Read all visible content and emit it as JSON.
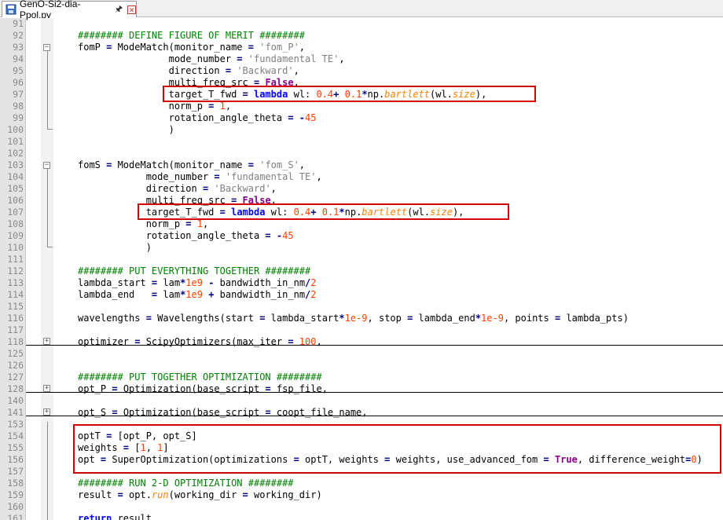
{
  "tab": {
    "filename": "GenO-Si2-dia-Ppol.py",
    "pin_icon": "pin-icon",
    "close_icon": "close-icon"
  },
  "lines": [
    {
      "n": "91",
      "t": []
    },
    {
      "n": "92",
      "t": [
        [
          "cm",
          "######## DEFINE FIGURE OF MERIT ########"
        ]
      ]
    },
    {
      "n": "93",
      "t": [
        [
          "",
          "fomP "
        ],
        [
          "op",
          "="
        ],
        [
          "",
          " ModeMatch(monitor_name "
        ],
        [
          "op",
          "="
        ],
        [
          "",
          " "
        ],
        [
          "str",
          "'fom_P'"
        ],
        [
          "",
          ","
        ]
      ]
    },
    {
      "n": "94",
      "t": [
        [
          "",
          "                mode_number "
        ],
        [
          "op",
          "="
        ],
        [
          "",
          " "
        ],
        [
          "str",
          "'fundamental TE'"
        ],
        [
          "",
          ","
        ]
      ]
    },
    {
      "n": "95",
      "t": [
        [
          "",
          "                direction "
        ],
        [
          "op",
          "="
        ],
        [
          "",
          " "
        ],
        [
          "str",
          "'Backward'"
        ],
        [
          "",
          ","
        ]
      ]
    },
    {
      "n": "96",
      "t": [
        [
          "",
          "                multi_freq_src "
        ],
        [
          "op",
          "="
        ],
        [
          "",
          " "
        ],
        [
          "bi",
          "False"
        ],
        [
          "",
          ","
        ]
      ]
    },
    {
      "n": "97",
      "t": [
        [
          "",
          "                target_T_fwd "
        ],
        [
          "op",
          "="
        ],
        [
          "",
          " "
        ],
        [
          "kw",
          "lambda"
        ],
        [
          "",
          " wl: "
        ],
        [
          "num",
          "0.4"
        ],
        [
          "op",
          "+"
        ],
        [
          "",
          " "
        ],
        [
          "num",
          "0.1"
        ],
        [
          "op",
          "*"
        ],
        [
          "",
          "np."
        ],
        [
          "it",
          "bartlett"
        ],
        [
          "",
          "(wl."
        ],
        [
          "it",
          "size"
        ],
        [
          "",
          "),"
        ]
      ]
    },
    {
      "n": "98",
      "t": [
        [
          "",
          "                norm_p "
        ],
        [
          "op",
          "="
        ],
        [
          "",
          " "
        ],
        [
          "num",
          "1"
        ],
        [
          "",
          ","
        ]
      ]
    },
    {
      "n": "99",
      "t": [
        [
          "",
          "                rotation_angle_theta "
        ],
        [
          "op",
          "="
        ],
        [
          "",
          " "
        ],
        [
          "op",
          "-"
        ],
        [
          "num",
          "45"
        ]
      ]
    },
    {
      "n": "100",
      "t": [
        [
          "",
          "                )"
        ]
      ]
    },
    {
      "n": "101",
      "t": []
    },
    {
      "n": "102",
      "t": []
    },
    {
      "n": "103",
      "t": [
        [
          "",
          "fomS "
        ],
        [
          "op",
          "="
        ],
        [
          "",
          " ModeMatch(monitor_name "
        ],
        [
          "op",
          "="
        ],
        [
          "",
          " "
        ],
        [
          "str",
          "'fom_S'"
        ],
        [
          "",
          ","
        ]
      ]
    },
    {
      "n": "104",
      "t": [
        [
          "",
          "            mode_number "
        ],
        [
          "op",
          "="
        ],
        [
          "",
          " "
        ],
        [
          "str",
          "'fundamental TE'"
        ],
        [
          "",
          ","
        ]
      ]
    },
    {
      "n": "105",
      "t": [
        [
          "",
          "            direction "
        ],
        [
          "op",
          "="
        ],
        [
          "",
          " "
        ],
        [
          "str",
          "'Backward'"
        ],
        [
          "",
          ","
        ]
      ]
    },
    {
      "n": "106",
      "t": [
        [
          "",
          "            multi_freq_src "
        ],
        [
          "op",
          "="
        ],
        [
          "",
          " "
        ],
        [
          "bi",
          "False"
        ],
        [
          "",
          ","
        ]
      ]
    },
    {
      "n": "107",
      "t": [
        [
          "",
          "            target_T_fwd "
        ],
        [
          "op",
          "="
        ],
        [
          "",
          " "
        ],
        [
          "kw",
          "lambda"
        ],
        [
          "",
          " wl: "
        ],
        [
          "num",
          "0.4"
        ],
        [
          "op",
          "+"
        ],
        [
          "",
          " "
        ],
        [
          "num",
          "0.1"
        ],
        [
          "op",
          "*"
        ],
        [
          "",
          "np."
        ],
        [
          "it",
          "bartlett"
        ],
        [
          "",
          "(wl."
        ],
        [
          "it",
          "size"
        ],
        [
          "",
          "),"
        ]
      ]
    },
    {
      "n": "108",
      "t": [
        [
          "",
          "            norm_p "
        ],
        [
          "op",
          "="
        ],
        [
          "",
          " "
        ],
        [
          "num",
          "1"
        ],
        [
          "",
          ","
        ]
      ]
    },
    {
      "n": "109",
      "t": [
        [
          "",
          "            rotation_angle_theta "
        ],
        [
          "op",
          "="
        ],
        [
          "",
          " "
        ],
        [
          "op",
          "-"
        ],
        [
          "num",
          "45"
        ]
      ]
    },
    {
      "n": "110",
      "t": [
        [
          "",
          "            )"
        ]
      ]
    },
    {
      "n": "111",
      "t": []
    },
    {
      "n": "112",
      "t": [
        [
          "cm",
          "######## PUT EVERYTHING TOGETHER ########"
        ]
      ]
    },
    {
      "n": "113",
      "t": [
        [
          "",
          "lambda_start "
        ],
        [
          "op",
          "="
        ],
        [
          "",
          " lam"
        ],
        [
          "op",
          "*"
        ],
        [
          "num",
          "1e9"
        ],
        [
          "",
          " "
        ],
        [
          "op",
          "-"
        ],
        [
          "",
          " bandwidth_in_nm"
        ],
        [
          "op",
          "/"
        ],
        [
          "num",
          "2"
        ]
      ]
    },
    {
      "n": "114",
      "t": [
        [
          "",
          "lambda_end   "
        ],
        [
          "op",
          "="
        ],
        [
          "",
          " lam"
        ],
        [
          "op",
          "*"
        ],
        [
          "num",
          "1e9"
        ],
        [
          "",
          " "
        ],
        [
          "op",
          "+"
        ],
        [
          "",
          " bandwidth_in_nm"
        ],
        [
          "op",
          "/"
        ],
        [
          "num",
          "2"
        ]
      ]
    },
    {
      "n": "115",
      "t": []
    },
    {
      "n": "116",
      "t": [
        [
          "",
          "wavelengths "
        ],
        [
          "op",
          "="
        ],
        [
          "",
          " Wavelengths(start "
        ],
        [
          "op",
          "="
        ],
        [
          "",
          " lambda_start"
        ],
        [
          "op",
          "*"
        ],
        [
          "num",
          "1e-9"
        ],
        [
          "",
          ", stop "
        ],
        [
          "op",
          "="
        ],
        [
          "",
          " lambda_end"
        ],
        [
          "op",
          "*"
        ],
        [
          "num",
          "1e-9"
        ],
        [
          "",
          ", points "
        ],
        [
          "op",
          "="
        ],
        [
          "",
          " lambda_pts)"
        ]
      ]
    },
    {
      "n": "117",
      "t": []
    },
    {
      "n": "118",
      "t": [
        [
          "",
          "optimizer "
        ],
        [
          "op",
          "="
        ],
        [
          "",
          " ScipyOptimizers(max_iter "
        ],
        [
          "op",
          "="
        ],
        [
          "",
          " "
        ],
        [
          "num",
          "100"
        ],
        [
          "",
          ","
        ]
      ]
    },
    {
      "n": "125",
      "t": []
    },
    {
      "n": "126",
      "t": []
    },
    {
      "n": "127",
      "t": [
        [
          "cm",
          "######## PUT TOGETHER OPTIMIZATION ########"
        ]
      ]
    },
    {
      "n": "128",
      "t": [
        [
          "",
          "opt_P "
        ],
        [
          "op",
          "="
        ],
        [
          "",
          " Optimization(base_script "
        ],
        [
          "op",
          "="
        ],
        [
          "",
          " fsp_file,"
        ]
      ]
    },
    {
      "n": "140",
      "t": []
    },
    {
      "n": "141",
      "t": [
        [
          "",
          "opt_S "
        ],
        [
          "op",
          "="
        ],
        [
          "",
          " Optimization(base_script "
        ],
        [
          "op",
          "="
        ],
        [
          "",
          " coopt_file_name,"
        ]
      ]
    },
    {
      "n": "153",
      "t": []
    },
    {
      "n": "154",
      "t": [
        [
          "",
          "optT "
        ],
        [
          "op",
          "="
        ],
        [
          "",
          " [opt_P, opt_S]"
        ]
      ]
    },
    {
      "n": "155",
      "t": [
        [
          "",
          "weights "
        ],
        [
          "op",
          "="
        ],
        [
          "",
          " ["
        ],
        [
          "num",
          "1"
        ],
        [
          "",
          ", "
        ],
        [
          "num",
          "1"
        ],
        [
          "",
          "]"
        ]
      ]
    },
    {
      "n": "156",
      "t": [
        [
          "",
          "opt "
        ],
        [
          "op",
          "="
        ],
        [
          "",
          " SuperOptimization(optimizations "
        ],
        [
          "op",
          "="
        ],
        [
          "",
          " optT, weights "
        ],
        [
          "op",
          "="
        ],
        [
          "",
          " weights, use_advanced_fom "
        ],
        [
          "op",
          "="
        ],
        [
          "",
          " "
        ],
        [
          "bi",
          "True"
        ],
        [
          "",
          ", difference_weight"
        ],
        [
          "op",
          "="
        ],
        [
          "num",
          "0"
        ],
        [
          "",
          ")"
        ]
      ]
    },
    {
      "n": "157",
      "t": []
    },
    {
      "n": "158",
      "t": [
        [
          "cm",
          "######## RUN 2-D OPTIMIZATION ########"
        ]
      ]
    },
    {
      "n": "159",
      "t": [
        [
          "",
          "result "
        ],
        [
          "op",
          "="
        ],
        [
          "",
          " opt."
        ],
        [
          "it",
          "run"
        ],
        [
          "",
          "(working_dir "
        ],
        [
          "op",
          "="
        ],
        [
          "",
          " working_dir)"
        ]
      ]
    },
    {
      "n": "160",
      "t": []
    },
    {
      "n": "161",
      "t": [
        [
          "kw",
          "return"
        ],
        [
          "",
          " result"
        ]
      ]
    }
  ]
}
